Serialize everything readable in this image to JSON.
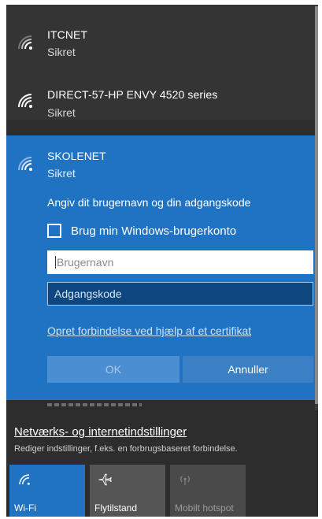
{
  "networks": [
    {
      "name": "ITCNET",
      "status": "Sikret"
    },
    {
      "name": "DIRECT-57-HP ENVY 4520 series",
      "status": "Sikret"
    }
  ],
  "active_network": {
    "name": "SKOLENET",
    "status": "Sikret",
    "prompt": "Angiv dit brugernavn og din adgangskode",
    "checkbox_label": "Brug min Windows-brugerkonto",
    "checkbox_checked": false,
    "username_placeholder": "Brugernavn",
    "password_placeholder": "Adgangskode",
    "cert_link": "Opret forbindelse ved hjælp af et certifikat",
    "ok_label": "OK",
    "cancel_label": "Annuller"
  },
  "settings": {
    "link": "Netværks- og internetindstillinger",
    "description": "Rediger indstillinger, f.eks. en forbrugsbaseret forbindelse."
  },
  "quick_actions": [
    {
      "label": "Wi-Fi",
      "icon": "wifi-icon",
      "state": "on"
    },
    {
      "label": "Flytilstand",
      "icon": "airplane-icon",
      "state": "off"
    },
    {
      "label": "Mobilt hotspot",
      "icon": "hotspot-icon",
      "state": "disabled"
    }
  ],
  "colors": {
    "accent": "#1f73c2",
    "panel_bg": "#2d2d2d"
  }
}
